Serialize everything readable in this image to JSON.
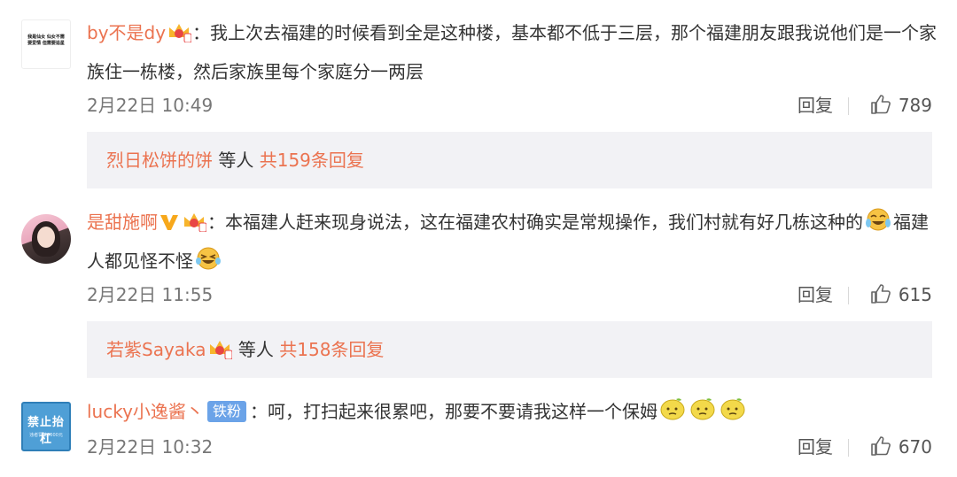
{
  "comments": [
    {
      "username": "by不是dy",
      "text": "：我上次去福建的时候看到全是这种楼，基本都不低于三层，那个福建朋友跟我说他们是一个家族住一栋楼，然后家族里每个家庭分一两层",
      "time": "2月22日 10:49",
      "reply_label": "回复",
      "likes": "789",
      "avatar_text": "我是仙女 仙女不需要爱情 但需要追星",
      "icons": [
        "crown-badge-icon"
      ]
    },
    {
      "username": "是甜施啊",
      "text_main": "：本福建人赶来现身说法，这在福建农村确实是常规操作，我们村就有好几栋这种的",
      "text_mid": "福建人都见怪不怪",
      "time": "2月22日 11:55",
      "reply_label": "回复",
      "likes": "615",
      "icons": [
        "verified-v-icon",
        "crown-badge-icon",
        "crying-laugh-emoji-icon",
        "laughing-emoji-icon"
      ]
    },
    {
      "username": "lucky小逸酱丶",
      "fan_badge": "铁粉",
      "text": "：呵，打扫起来很累吧，那要不要请我这样一个保姆",
      "time": "2月22日 10:32",
      "reply_label": "回复",
      "likes": "670",
      "avatar_title": "禁止抬杠",
      "avatar_sub": "违者罚款5000元",
      "icons": [
        "lemon-emoji-icon",
        "lemon-emoji-icon",
        "lemon-emoji-icon"
      ]
    }
  ],
  "subreplies": [
    {
      "user": "烈日松饼的饼",
      "middle": " 等人 ",
      "total": "共159条回复"
    },
    {
      "user": "若紫Sayaka",
      "middle": " 等人 ",
      "total": "共158条回复"
    }
  ],
  "colors": {
    "username": "#eb7350",
    "meta": "#777777",
    "subreply_bg": "#f2f2f5",
    "fan_badge": "#6ba3e8"
  }
}
